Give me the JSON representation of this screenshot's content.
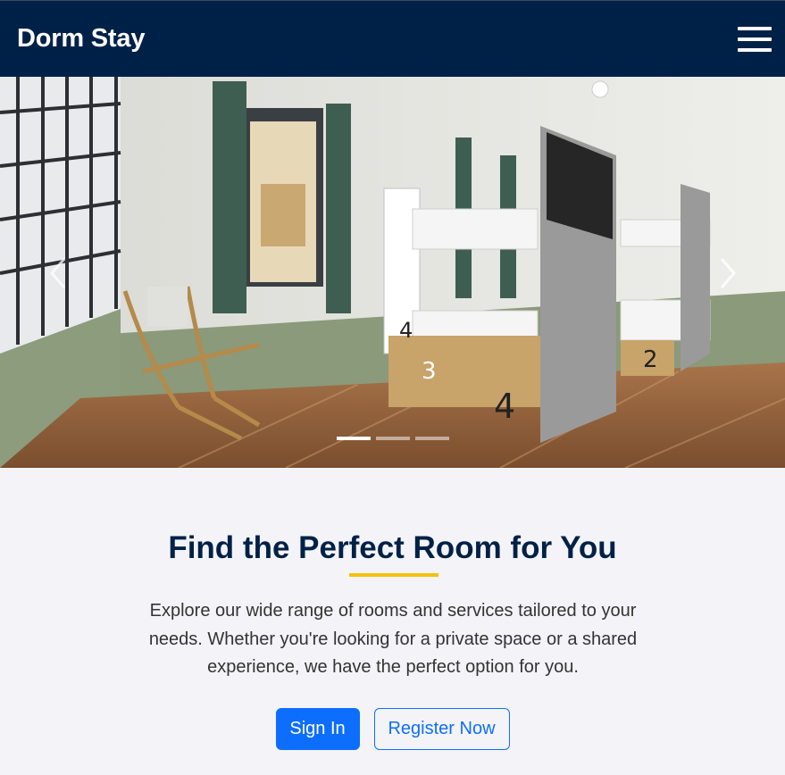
{
  "navbar": {
    "brand": "Dorm Stay",
    "menu_icon": "hamburger-menu-icon"
  },
  "carousel": {
    "slide_count": 3,
    "active_index": 0,
    "prev_icon": "chevron-left-icon",
    "next_icon": "chevron-right-icon",
    "bed_numbers": [
      "3",
      "4",
      "3",
      "4",
      "2"
    ]
  },
  "hero": {
    "title": "Find the Perfect Room for You",
    "description": "Explore our wide range of rooms and services tailored to your needs. Whether you're looking for a private space or a shared experience, we have the perfect option for you.",
    "signin_label": "Sign In",
    "register_label": "Register Now"
  },
  "colors": {
    "navbar_bg": "#002147",
    "accent_yellow": "#f4c20d",
    "primary_blue": "#0d6efd",
    "page_bg": "#f4f4f8"
  }
}
